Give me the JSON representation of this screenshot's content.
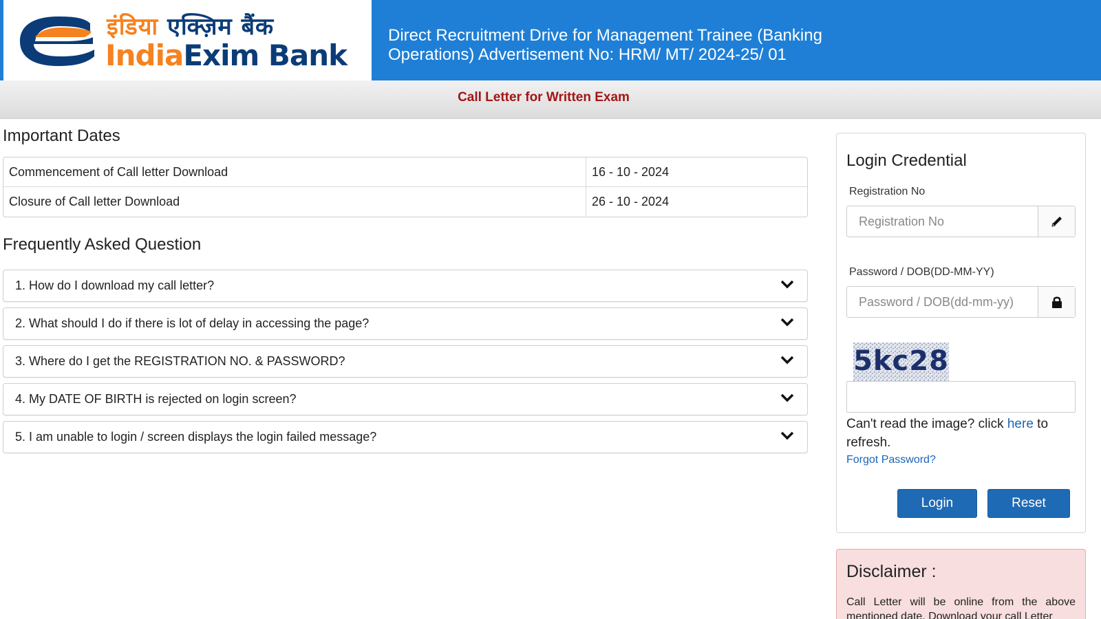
{
  "header": {
    "logo_hindi_part1": "इंडिया",
    "logo_hindi_part2": "एक्ज़िम बैंक",
    "logo_en_part1": "India",
    "logo_en_part2": "Exim Bank",
    "title": "Direct Recruitment Drive for Management Trainee (Banking Operations) Advertisement No: HRM/ MT/ 2024-25/ 01"
  },
  "subbar": {
    "title": "Call Letter for Written Exam"
  },
  "important_dates": {
    "heading": "Important Dates",
    "rows": [
      {
        "label": "Commencement of Call letter Download",
        "value": "16 - 10 - 2024"
      },
      {
        "label": "Closure of Call letter Download",
        "value": "26 - 10 - 2024"
      }
    ]
  },
  "faq": {
    "heading": "Frequently Asked Question",
    "items": [
      "1. How do I download my call letter?",
      "2. What should I do if there is lot of delay in accessing the page?",
      "3. Where do I get the REGISTRATION NO. & PASSWORD?",
      "4. My DATE OF BIRTH is rejected on login screen?",
      "5. I am unable to login / screen displays the login failed message?"
    ]
  },
  "login": {
    "heading": "Login Credential",
    "reg_label": "Registration No",
    "reg_placeholder": "Registration No",
    "pwd_label": "Password / DOB(DD-MM-YY)",
    "pwd_placeholder": "Password / DOB(dd-mm-yy)",
    "captcha_text": "5kc28",
    "captcha_help_pre": "Can't read the image? click ",
    "captcha_help_link": "here",
    "captcha_help_post": " to refresh.",
    "forgot": "Forgot Password?",
    "login_btn": "Login",
    "reset_btn": "Reset",
    "icons": {
      "username": "pencil-icon",
      "password": "lock-icon"
    }
  },
  "disclaimer": {
    "heading": "Disclaimer :",
    "text": "Call Letter will be online from the above mentioned date. Download your call Letter"
  },
  "colors": {
    "header_bg": "#1f7fd6",
    "brand_orange": "#f58220",
    "brand_navy": "#0b3c77",
    "accent_red": "#a31515",
    "button_blue": "#1f6ab5"
  }
}
